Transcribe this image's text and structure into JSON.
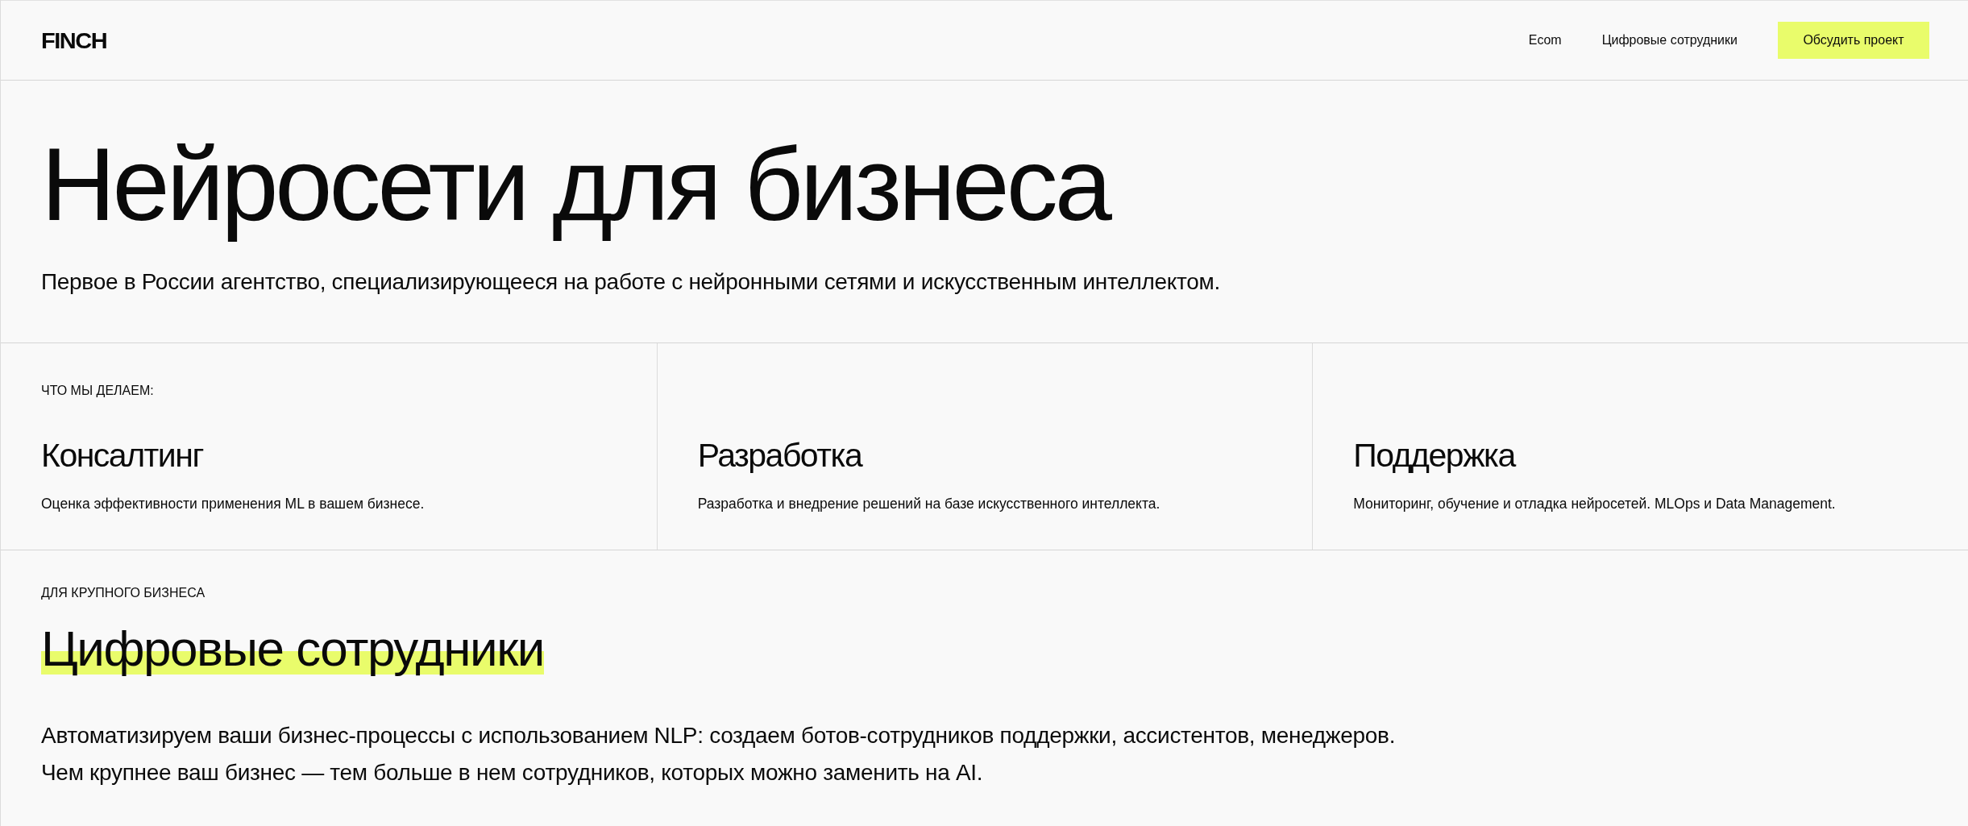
{
  "header": {
    "logo": "FINCH",
    "nav": [
      {
        "label": "Ecom"
      },
      {
        "label": "Цифровые сотрудники"
      }
    ],
    "cta": "Обсудить проект"
  },
  "hero": {
    "title": "Нейросети для бизнеса",
    "subtitle": "Первое в России агентство, специализирующееся на работе с нейронными сетями и искусственным интеллектом."
  },
  "services": {
    "label": "ЧТО МЫ ДЕЛАЕМ:",
    "items": [
      {
        "title": "Консалтинг",
        "description": "Оценка эффективности применения ML в вашем бизнесе."
      },
      {
        "title": "Разработка",
        "description": "Разработка и внедрение решений на базе искусственного интеллекта."
      },
      {
        "title": "Поддержка",
        "description": "Мониторинг, обучение и отладка нейросетей. MLOps и Data Management."
      }
    ]
  },
  "feature": {
    "label": "ДЛЯ КРУПНОГО БИЗНЕСА",
    "title": "Цифровые сотрудники",
    "highlighted": true,
    "lines": [
      "Автоматизируем ваши бизнес-процессы с использованием NLP: создаем ботов-сотрудников поддержки, ассистентов, менеджеров.",
      "Чем крупнее ваш бизнес — тем больше в нем сотрудников, которых можно заменить на AI."
    ]
  }
}
